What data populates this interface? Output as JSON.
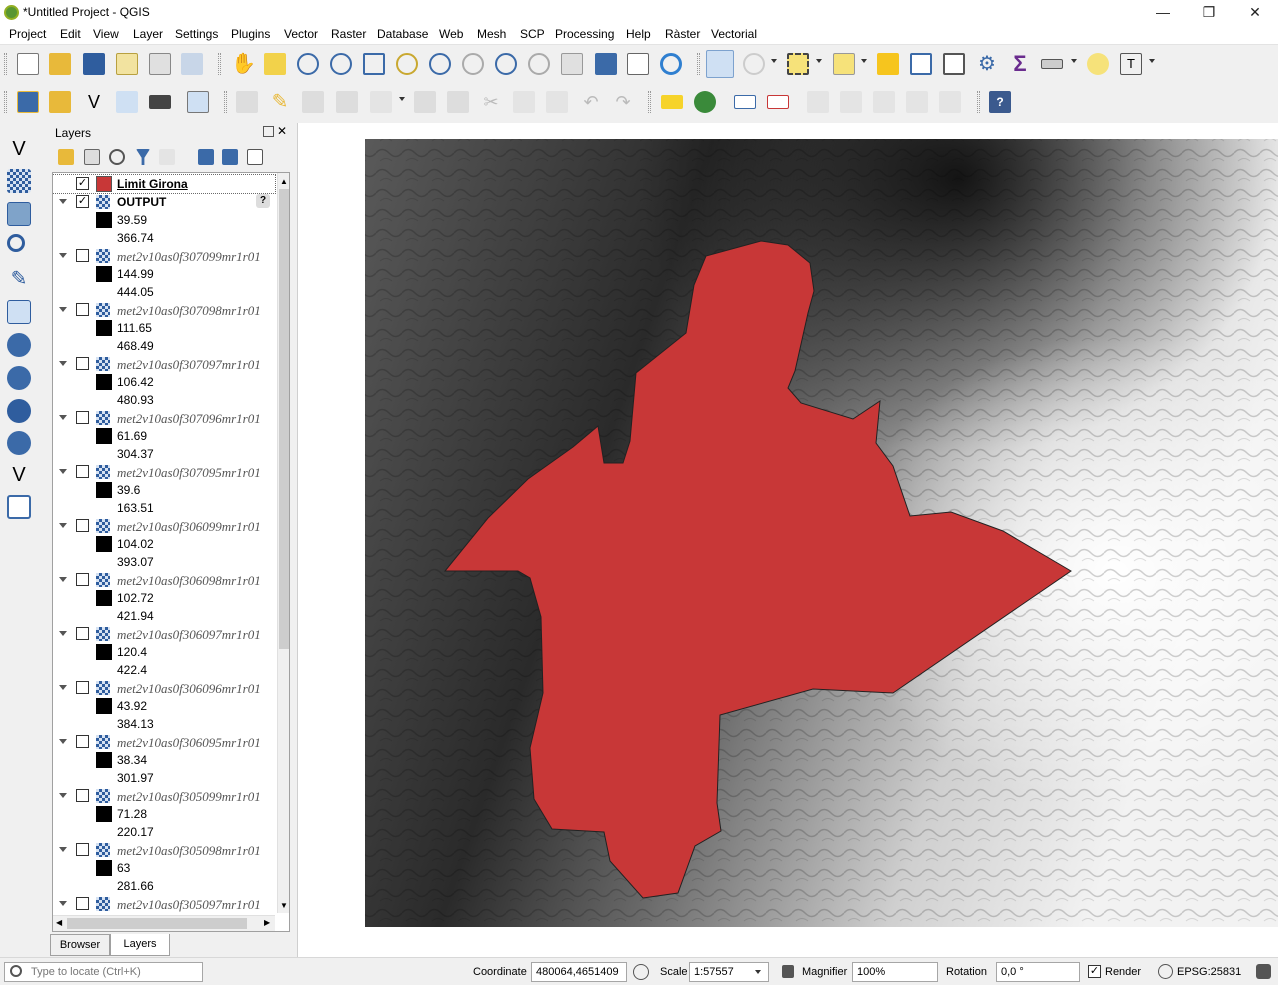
{
  "window": {
    "title": "*Untitled Project - QGIS"
  },
  "menu": [
    "Project",
    "Edit",
    "View",
    "Layer",
    "Settings",
    "Plugins",
    "Vector",
    "Raster",
    "Database",
    "Web",
    "Mesh",
    "SCP",
    "Processing",
    "Help",
    "Ràster",
    "Vectorial"
  ],
  "layers_panel": {
    "title": "Layers",
    "tabs": {
      "browser": "Browser",
      "layers": "Layers"
    },
    "items": [
      {
        "name": "Limit Girona",
        "checked": true,
        "kind": "vector",
        "color": "#c83737"
      },
      {
        "name": "OUTPUT",
        "checked": true,
        "kind": "raster",
        "min": "39.59",
        "max": "366.74"
      },
      {
        "name": "met2v10as0f307099mr1r01",
        "checked": false,
        "kind": "raster",
        "min": "144.99",
        "max": "444.05"
      },
      {
        "name": "met2v10as0f307098mr1r01",
        "checked": false,
        "kind": "raster",
        "min": "111.65",
        "max": "468.49"
      },
      {
        "name": "met2v10as0f307097mr1r01",
        "checked": false,
        "kind": "raster",
        "min": "106.42",
        "max": "480.93"
      },
      {
        "name": "met2v10as0f307096mr1r01",
        "checked": false,
        "kind": "raster",
        "min": "61.69",
        "max": "304.37"
      },
      {
        "name": "met2v10as0f307095mr1r01",
        "checked": false,
        "kind": "raster",
        "min": "39.6",
        "max": "163.51"
      },
      {
        "name": "met2v10as0f306099mr1r01",
        "checked": false,
        "kind": "raster",
        "min": "104.02",
        "max": "393.07"
      },
      {
        "name": "met2v10as0f306098mr1r01",
        "checked": false,
        "kind": "raster",
        "min": "102.72",
        "max": "421.94"
      },
      {
        "name": "met2v10as0f306097mr1r01",
        "checked": false,
        "kind": "raster",
        "min": "120.4",
        "max": "422.4"
      },
      {
        "name": "met2v10as0f306096mr1r01",
        "checked": false,
        "kind": "raster",
        "min": "43.92",
        "max": "384.13"
      },
      {
        "name": "met2v10as0f306095mr1r01",
        "checked": false,
        "kind": "raster",
        "min": "38.34",
        "max": "301.97"
      },
      {
        "name": "met2v10as0f305099mr1r01",
        "checked": false,
        "kind": "raster",
        "min": "71.28",
        "max": "220.17"
      },
      {
        "name": "met2v10as0f305098mr1r01",
        "checked": false,
        "kind": "raster",
        "min": "63",
        "max": "281.66"
      },
      {
        "name": "met2v10as0f305097mr1r01",
        "checked": false,
        "kind": "raster",
        "min": "",
        "max": ""
      }
    ]
  },
  "statusbar": {
    "locate_placeholder": "Type to locate (Ctrl+K)",
    "coordinate_label": "Coordinate",
    "coordinate_value": "480064,4651409",
    "scale_label": "Scale",
    "scale_value": "1:57557",
    "magnifier_label": "Magnifier",
    "magnifier_value": "100%",
    "rotation_label": "Rotation",
    "rotation_value": "0,0 °",
    "render_label": "Render",
    "render_checked": true,
    "crs": "EPSG:25831"
  },
  "colors": {
    "polygon_fill": "#c83737",
    "dem_low": "#000000",
    "dem_high": "#ffffff"
  }
}
